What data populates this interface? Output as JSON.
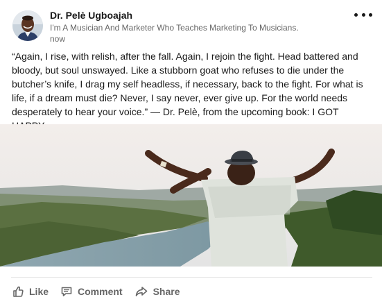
{
  "post": {
    "author_name": "Dr. Pelè Ugboajah",
    "author_headline": "I'm A Musician And Marketer Who Teaches Marketing To Musicians.",
    "timestamp": "now",
    "body": "“Again, I rise, with relish, after the fall. Again, I rejoin the fight. Head battered and bloody, but soul unswayed. Like a stubborn goat who refuses to die under the butcher’s knife, I drag my self headless, if necessary, back to the fight. For what is life, if a dream must die? Never, I say never, ever give up. For the world needs desperately to hear your voice.” — Dr. Pelè, from the upcoming book: I GOT HAPPY."
  },
  "actions": {
    "like_label": "Like",
    "comment_label": "Comment",
    "share_label": "Share"
  },
  "icons": {
    "more": "more-icon",
    "like": "thumbs-up-icon",
    "comment": "comment-icon",
    "share": "share-arrow-icon"
  },
  "colors": {
    "text_primary": "#191919",
    "text_secondary": "#666666",
    "divider": "#e6e6e6"
  }
}
